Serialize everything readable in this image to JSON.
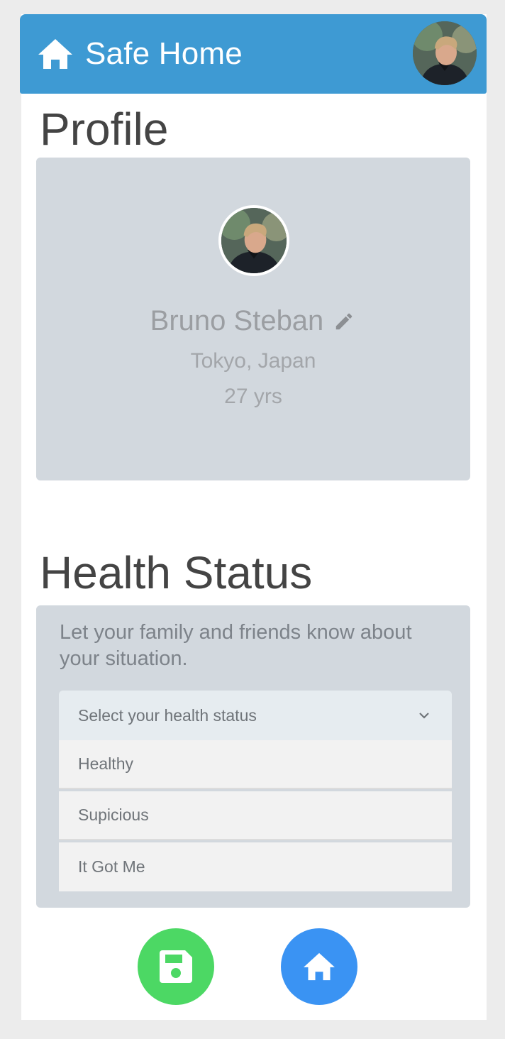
{
  "header": {
    "title": "Safe Home",
    "icon": "home-icon",
    "color": "#3e9ad3"
  },
  "profile": {
    "section_title": "Profile",
    "name": "Bruno Steban",
    "location": "Tokyo, Japan",
    "age": "27 yrs",
    "edit_icon": "pencil-icon"
  },
  "health": {
    "section_title": "Health Status",
    "description": "Let your family and friends know about your situation.",
    "select": {
      "placeholder": "Select your health status",
      "options": [
        "Healthy",
        "Supicious",
        "It Got Me"
      ]
    }
  },
  "actions": {
    "save_icon": "floppy-disk-icon",
    "save_color": "#4cd864",
    "home_icon": "home-icon",
    "home_color": "#3a93f3"
  }
}
